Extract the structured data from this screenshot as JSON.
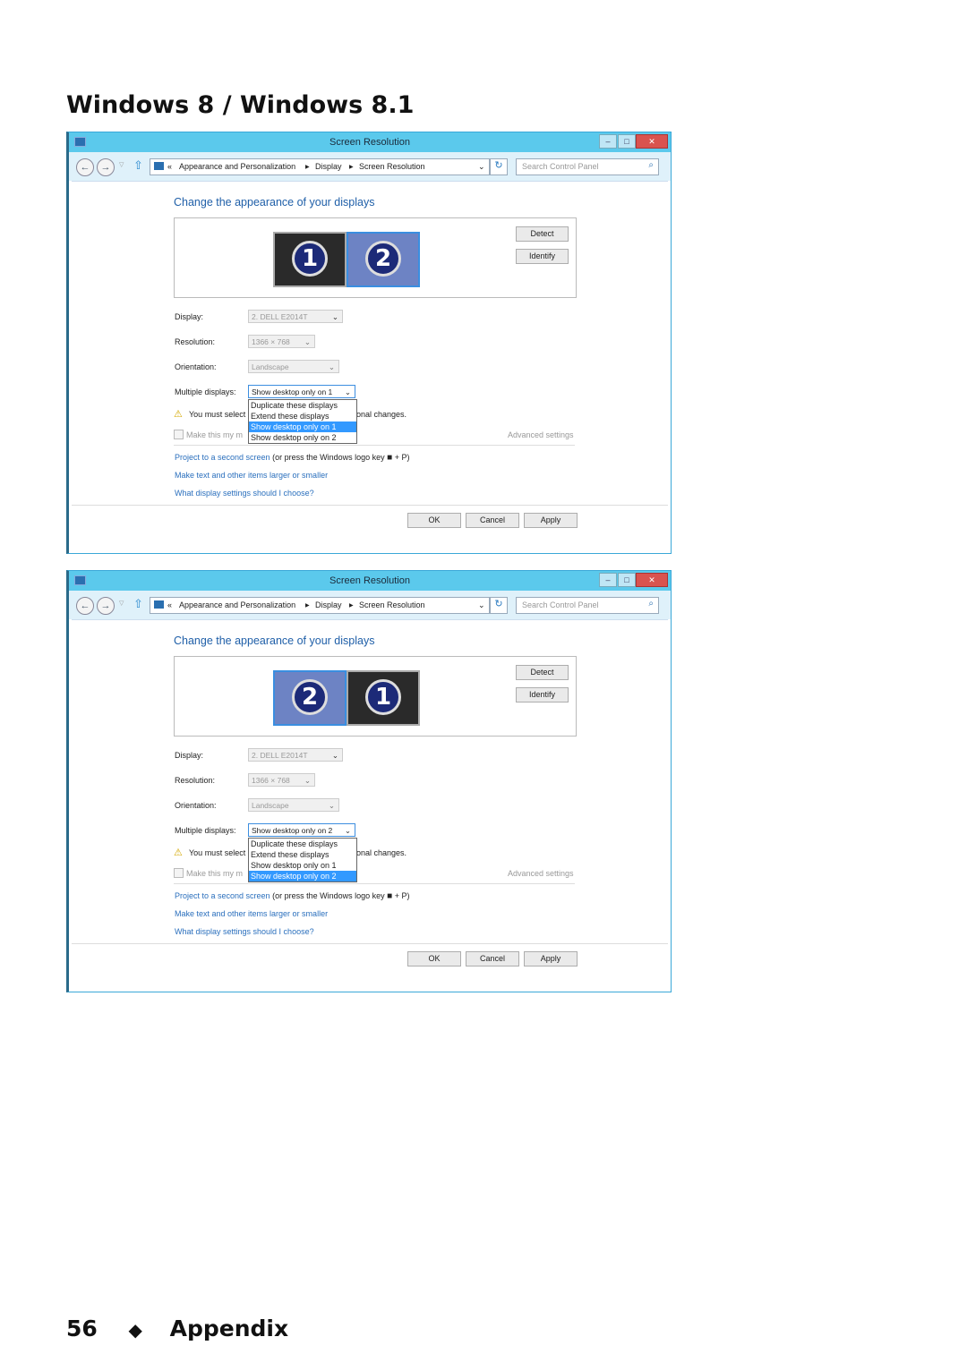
{
  "heading": "Windows 8 / Windows 8.1",
  "footer": {
    "page_number": "56",
    "bullet": "◆",
    "section": "Appendix"
  },
  "windows": [
    {
      "title": "Screen Resolution",
      "breadcrumb": [
        "«",
        "Appearance and Personalization",
        "Display",
        "Screen Resolution"
      ],
      "search_placeholder": "Search Control Panel",
      "page_heading": "Change the appearance of your displays",
      "monitors": [
        {
          "number": "1",
          "selected": false
        },
        {
          "number": "2",
          "selected": true
        }
      ],
      "detect": "Detect",
      "identify": "Identify",
      "display_label": "Display:",
      "display_value": "2. DELL E2014T",
      "resolution_label": "Resolution:",
      "resolution_value": "1366 × 768",
      "orientation_label": "Orientation:",
      "orientation_value": "Landscape",
      "multiple_label": "Multiple displays:",
      "multiple_value": "Show desktop only on 1",
      "dropdown_options": [
        "Duplicate these displays",
        "Extend these displays",
        "Show desktop only on 1",
        "Show desktop only on 2"
      ],
      "highlighted_option": 2,
      "warning_left": "You must select",
      "warning_right": "onal changes.",
      "checkbox_label": "Make this my m",
      "advanced": "Advanced settings",
      "link_project": "Project to a second screen",
      "project_suffix": "(or press the Windows logo key",
      "project_key": "+ P)",
      "link_text_size": "Make text and other items larger or smaller",
      "link_settings": "What display settings should I choose?",
      "ok": "OK",
      "cancel": "Cancel",
      "apply": "Apply"
    },
    {
      "title": "Screen Resolution",
      "breadcrumb": [
        "«",
        "Appearance and Personalization",
        "Display",
        "Screen Resolution"
      ],
      "search_placeholder": "Search Control Panel",
      "page_heading": "Change the appearance of your displays",
      "monitors": [
        {
          "number": "2",
          "selected": true
        },
        {
          "number": "1",
          "selected": false
        }
      ],
      "detect": "Detect",
      "identify": "Identify",
      "display_label": "Display:",
      "display_value": "2. DELL E2014T",
      "resolution_label": "Resolution:",
      "resolution_value": "1366 × 768",
      "orientation_label": "Orientation:",
      "orientation_value": "Landscape",
      "multiple_label": "Multiple displays:",
      "multiple_value": "Show desktop only on 2",
      "dropdown_options": [
        "Duplicate these displays",
        "Extend these displays",
        "Show desktop only on 1",
        "Show desktop only on 2"
      ],
      "highlighted_option": 3,
      "warning_left": "You must select",
      "warning_right": "onal changes.",
      "checkbox_label": "Make this my m",
      "advanced": "Advanced settings",
      "link_project": "Project to a second screen",
      "project_suffix": "(or press the Windows logo key",
      "project_key": "+ P)",
      "link_text_size": "Make text and other items larger or smaller",
      "link_settings": "What display settings should I choose?",
      "ok": "OK",
      "cancel": "Cancel",
      "apply": "Apply"
    }
  ]
}
